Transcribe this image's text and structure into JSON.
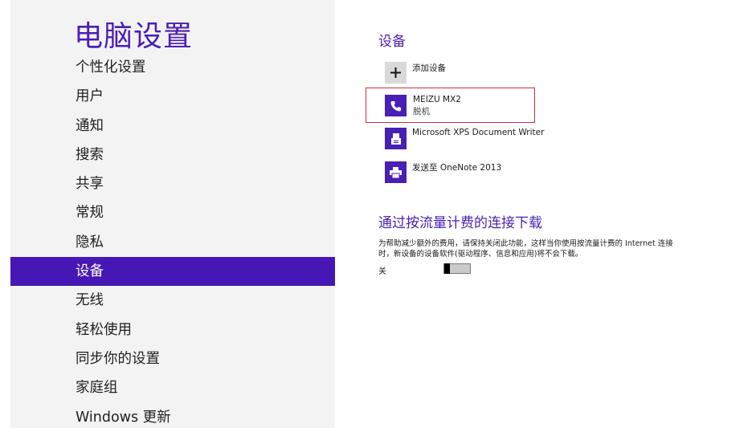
{
  "sidebar": {
    "title": "电脑设置",
    "items": [
      {
        "label": "个性化设置"
      },
      {
        "label": "用户"
      },
      {
        "label": "通知"
      },
      {
        "label": "搜索"
      },
      {
        "label": "共享"
      },
      {
        "label": "常规"
      },
      {
        "label": "隐私"
      },
      {
        "label": "设备",
        "selected": true
      },
      {
        "label": "无线"
      },
      {
        "label": "轻松使用"
      },
      {
        "label": "同步你的设置"
      },
      {
        "label": "家庭组"
      },
      {
        "label": "Windows 更新"
      }
    ]
  },
  "devices": {
    "title": "设备",
    "add_label": "添加设备",
    "list": [
      {
        "name": "MEIZU MX2",
        "status": "脱机",
        "icon": "phone-icon"
      },
      {
        "name": "Microsoft XPS Document Writer",
        "icon": "document-printer-icon"
      },
      {
        "name": "发送至 OneNote 2013",
        "icon": "printer-icon"
      }
    ]
  },
  "metered": {
    "title": "通过按流量计费的连接下载",
    "description": "为帮助减少额外的费用，请保持关闭此功能，这样当你使用按流量计费的 Internet 连接时，新设备的设备软件(驱动程序、信息和应用)将不会下载。",
    "toggle_label": "关",
    "toggle_on": false
  },
  "colors": {
    "accent": "#4a1fb3",
    "selected_bg": "#4617b4",
    "highlight_border": "#c8323c"
  }
}
